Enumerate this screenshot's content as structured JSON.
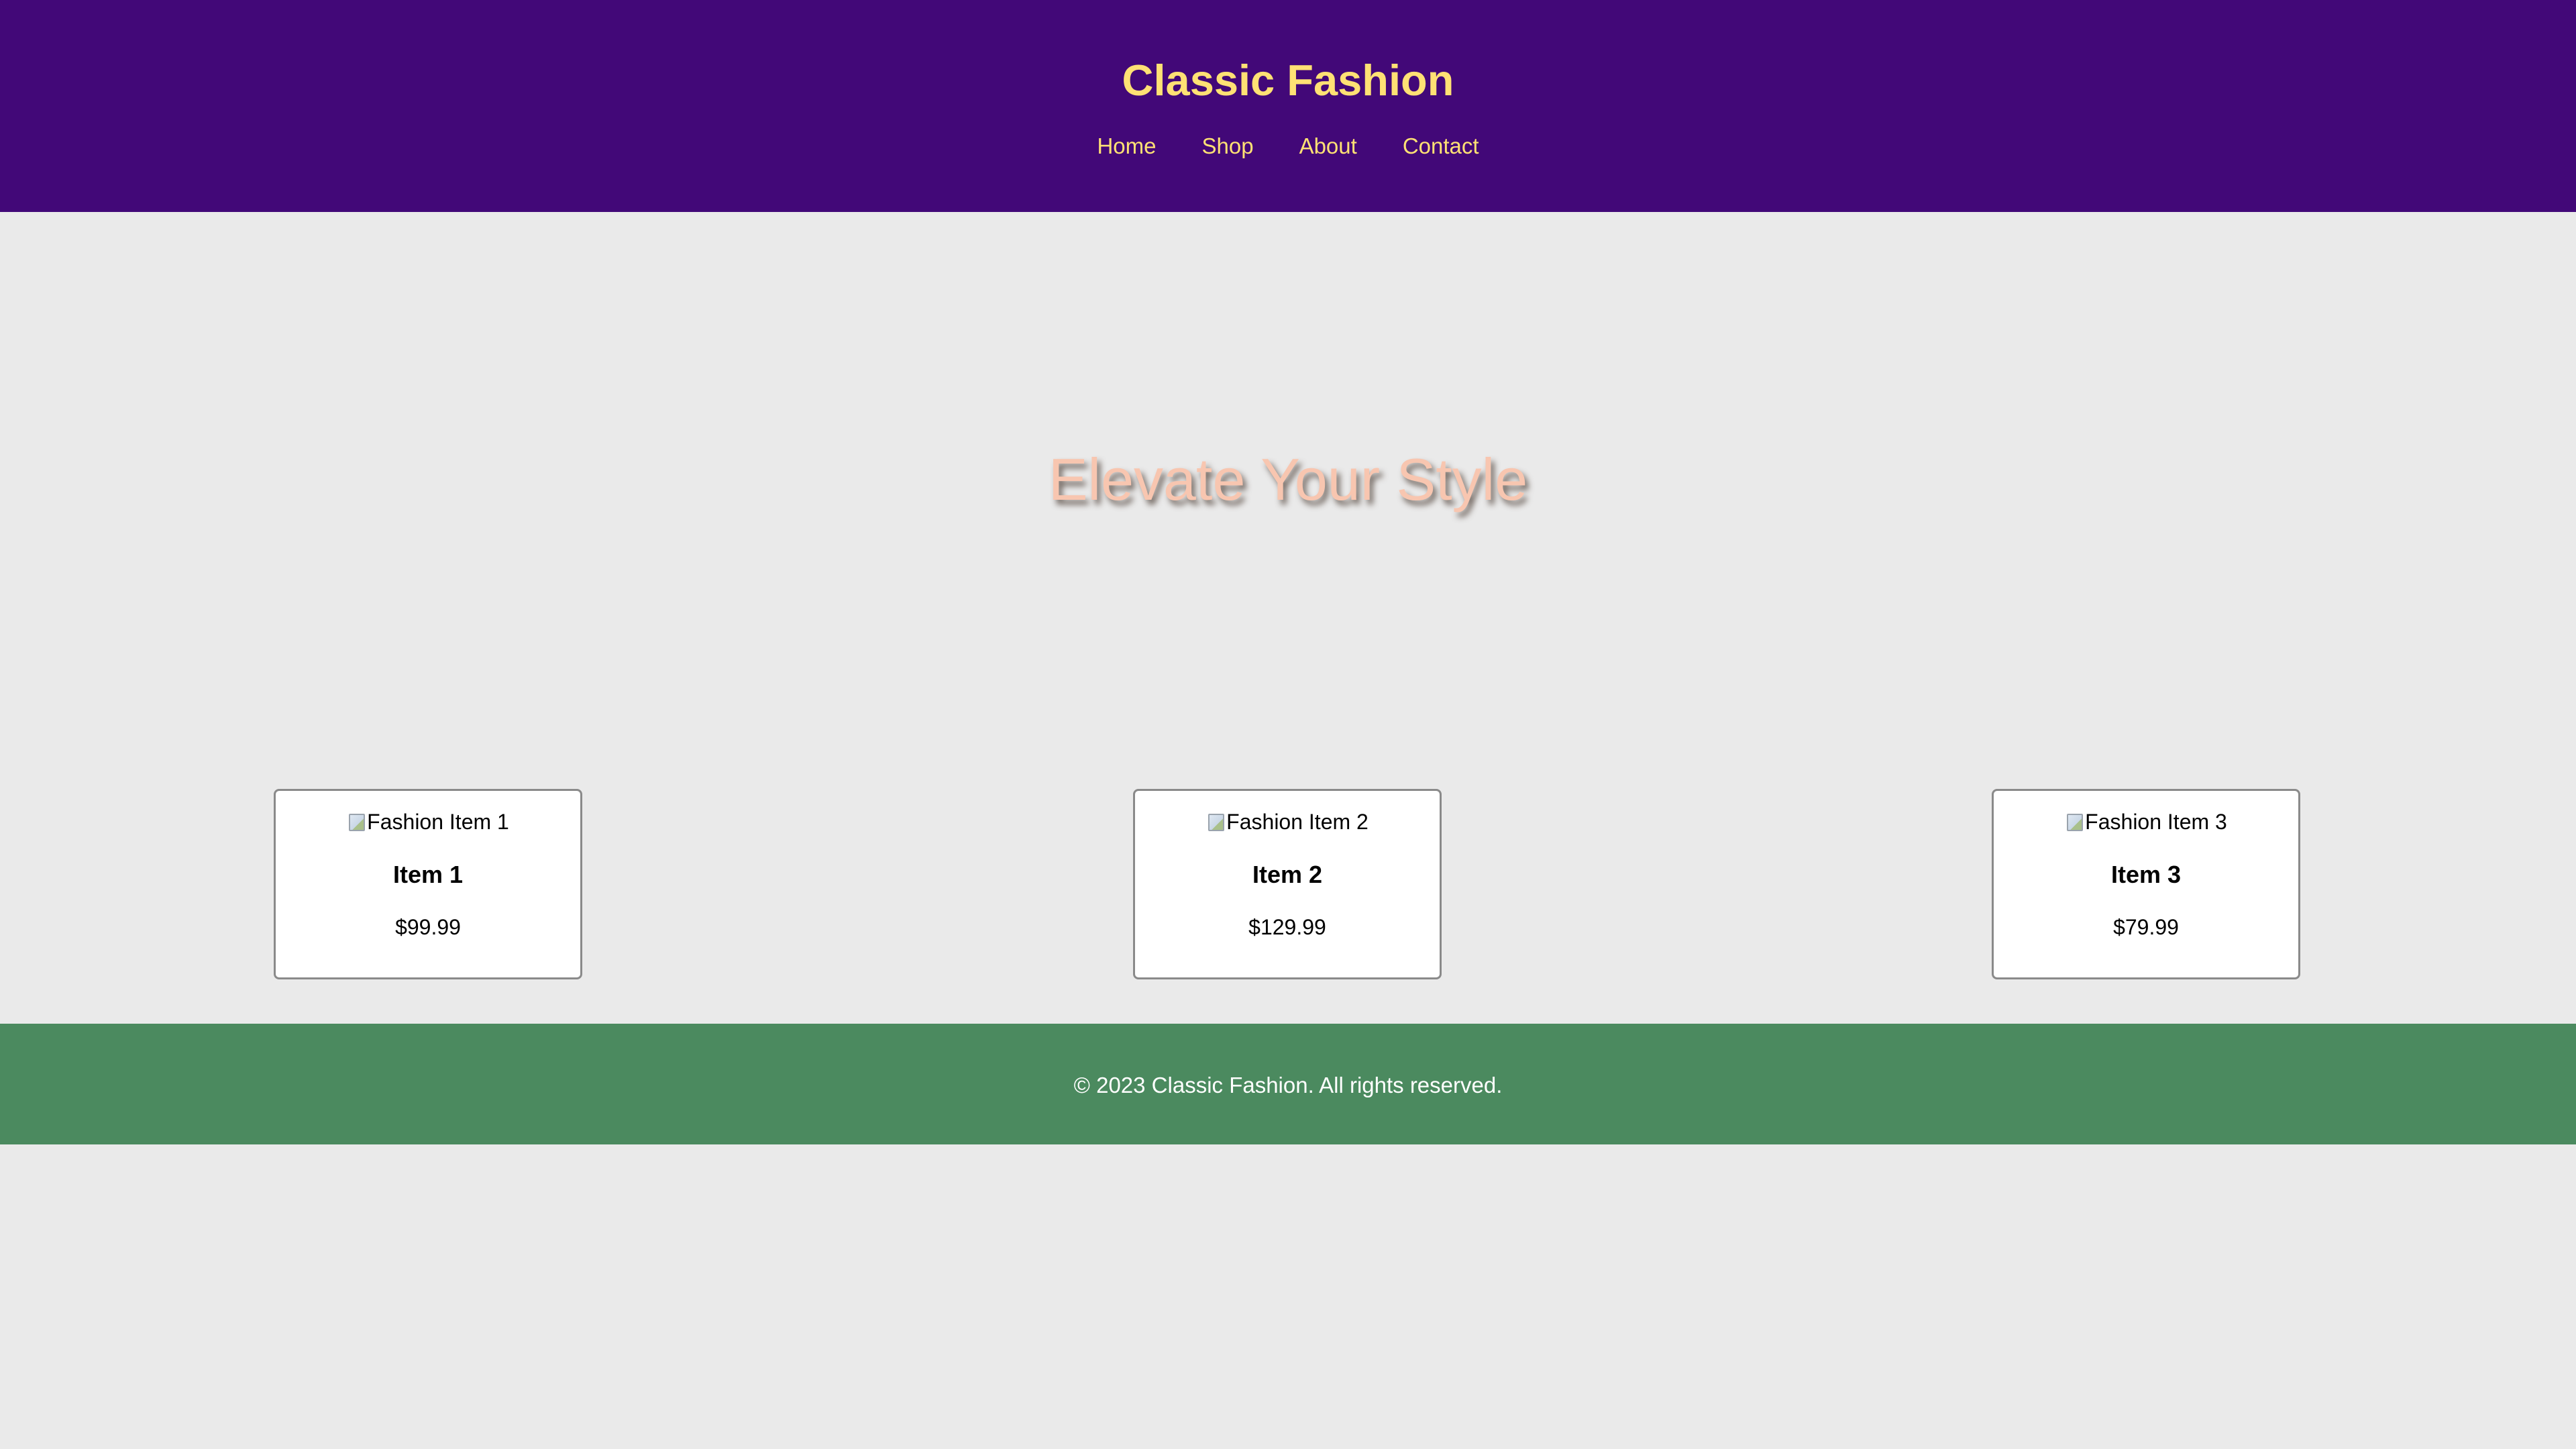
{
  "header": {
    "title": "Classic Fashion",
    "nav": [
      "Home",
      "Shop",
      "About",
      "Contact"
    ]
  },
  "hero": {
    "title": "Elevate Your Style"
  },
  "products": [
    {
      "image_alt": "Fashion Item 1",
      "name": "Item 1",
      "price": "$99.99"
    },
    {
      "image_alt": "Fashion Item 2",
      "name": "Item 2",
      "price": "$129.99"
    },
    {
      "image_alt": "Fashion Item 3",
      "name": "Item 3",
      "price": "$79.99"
    }
  ],
  "footer": {
    "text": "© 2023 Classic Fashion. All rights reserved."
  },
  "icons": {
    "product_image": "broken-image-icon"
  },
  "colors": {
    "header_bg": "#420878",
    "header_text": "#ffe174",
    "page_bg": "#eaeaea",
    "hero_text": "#f8c6b0",
    "footer_bg": "#4b8a5f",
    "footer_text": "#ffffff",
    "card_bg": "#ffffff"
  }
}
